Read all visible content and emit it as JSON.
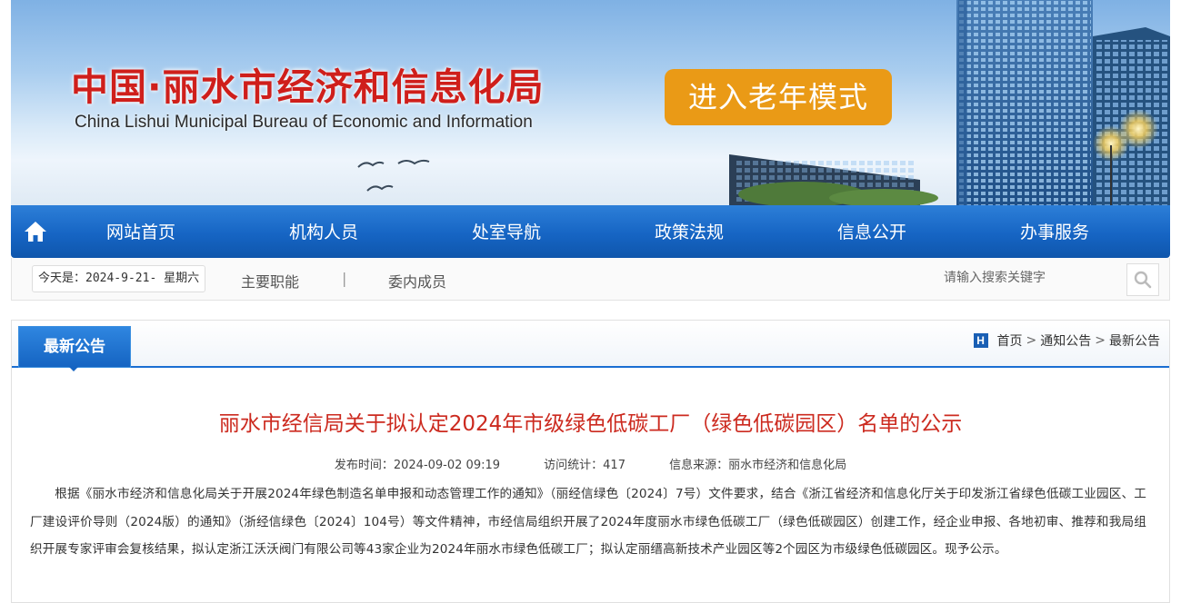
{
  "banner": {
    "title": "中国·丽水市经济和信息化局",
    "subtitle": "China Lishui Municipal Bureau of Economic and Information",
    "elder_mode": "进入老年模式"
  },
  "nav": {
    "home_icon": "home-icon",
    "items": [
      "网站首页",
      "机构人员",
      "处室导航",
      "政策法规",
      "信息公开",
      "办事服务"
    ]
  },
  "infobar": {
    "today": "今天是：2024-9-21- 星期六",
    "links": [
      "主要职能",
      "委内成员"
    ],
    "separator": "|",
    "search_placeholder": "请输入搜索关键字",
    "search_icon": "magnifier-icon"
  },
  "panel": {
    "tab": "最新公告",
    "breadcrumb": [
      "首页",
      "通知公告",
      "最新公告"
    ],
    "breadcrumb_icon": "H"
  },
  "article": {
    "title": "丽水市经信局关于拟认定2024年市级绿色低碳工厂（绿色低碳园区）名单的公示",
    "publish_time": "发布时间：2024-09-02 09:19",
    "visits": "访问统计：417",
    "source": "信息来源：丽水市经济和信息化局",
    "body": "根据《丽水市经济和信息化局关于开展2024年绿色制造名单申报和动态管理工作的通知》（丽经信绿色〔2024〕7号）文件要求，结合《浙江省经济和信息化厅关于印发浙江省绿色低碳工业园区、工厂建设评价导则（2024版）的通知》（浙经信绿色〔2024〕104号）等文件精神，市经信局组织开展了2024年度丽水市绿色低碳工厂（绿色低碳园区）创建工作，经企业申报、各地初审、推荐和我局组织开展专家评审会复核结果，拟认定浙江沃沃阀门有限公司等43家企业为2024年丽水市绿色低碳工厂；拟认定丽缙高新技术产业园区等2个园区为市级绿色低碳园区。现予公示。"
  }
}
